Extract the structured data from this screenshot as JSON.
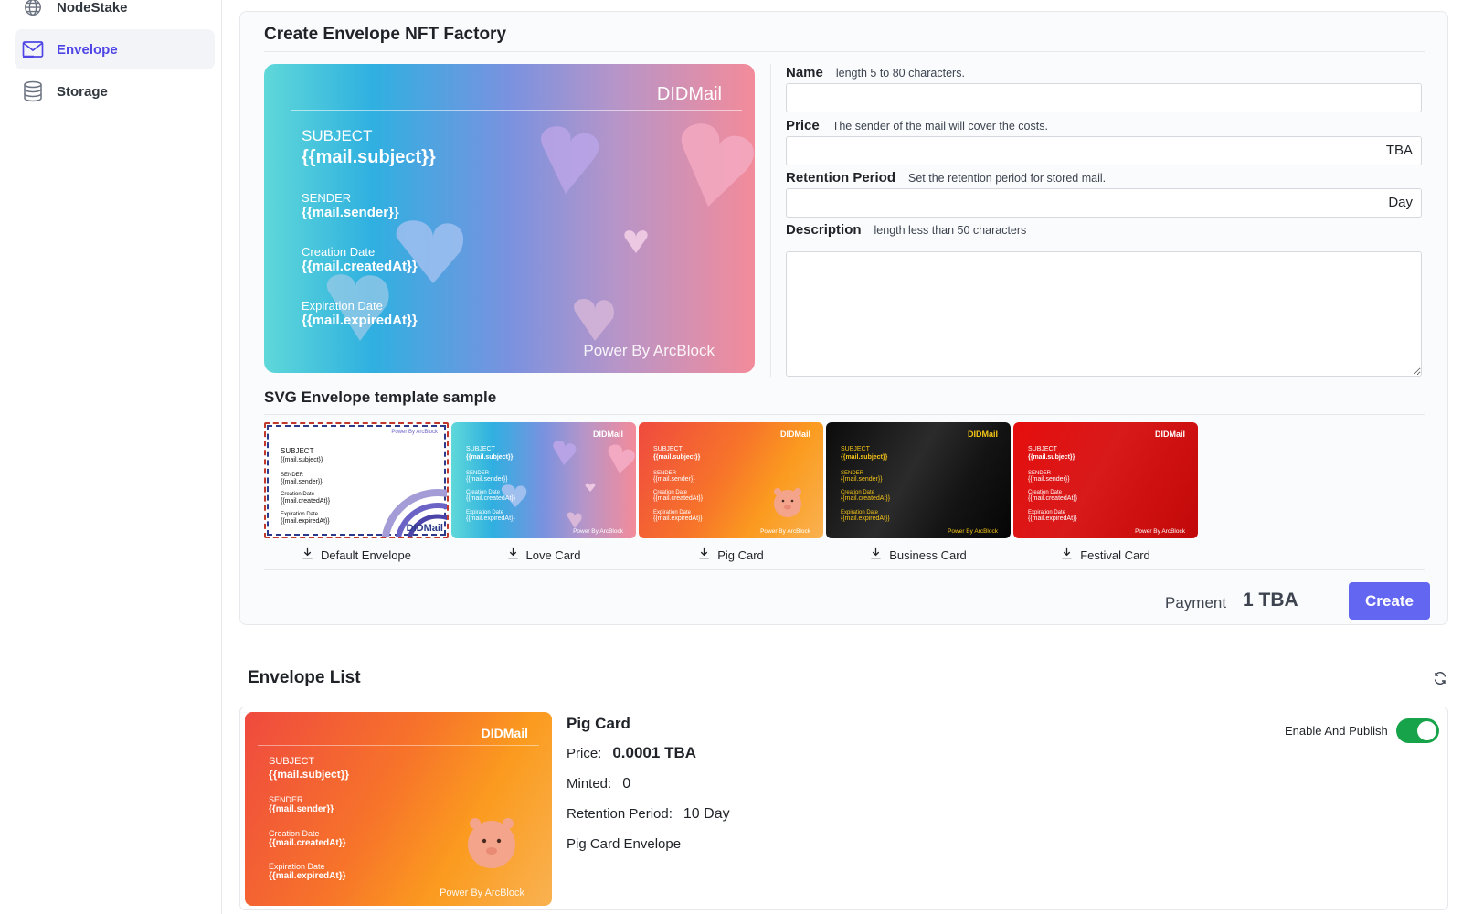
{
  "sidebar": {
    "items": [
      {
        "label": "NodeStake",
        "icon": "globe-icon"
      },
      {
        "label": "Envelope",
        "icon": "mail-icon"
      },
      {
        "label": "Storage",
        "icon": "database-icon"
      }
    ]
  },
  "factory": {
    "title": "Create Envelope NFT Factory",
    "preview": {
      "brand": "DIDMail",
      "subject_label": "SUBJECT",
      "subject_value": "{{mail.subject}}",
      "sender_label": "SENDER",
      "sender_value": "{{mail.sender}}",
      "created_label": "Creation Date",
      "created_value": "{{mail.createdAt}}",
      "expired_label": "Expiration Date",
      "expired_value": "{{mail.expiredAt}}",
      "power": "Power By ArcBlock"
    },
    "form": {
      "name_label": "Name",
      "name_hint": "length 5 to 80 characters.",
      "name_value": "",
      "price_label": "Price",
      "price_hint": "The sender of the mail will cover the costs.",
      "price_value": "",
      "price_suffix": "TBA",
      "retention_label": "Retention Period",
      "retention_hint": "Set the retention period for stored mail.",
      "retention_value": "",
      "retention_suffix": "Day",
      "description_label": "Description",
      "description_hint": "length less than 50 characters",
      "description_value": ""
    },
    "samples_title": "SVG Envelope template sample",
    "templates": [
      {
        "name": "Default Envelope",
        "brand": "DIDMail",
        "power": "Power By ArcBlock"
      },
      {
        "name": "Love Card",
        "brand": "DIDMail",
        "power": "Power By ArcBlock"
      },
      {
        "name": "Pig Card",
        "brand": "DIDMail",
        "power": "Power By ArcBlock"
      },
      {
        "name": "Business Card",
        "brand": "DIDMail",
        "power": "Power By ArcBlock"
      },
      {
        "name": "Festival Card",
        "brand": "DIDMail",
        "power": "Power By ArcBlock"
      }
    ],
    "template_fields": {
      "subject_label": "SUBJECT",
      "subject_value": "{{mail.subject}}",
      "sender_label": "SENDER",
      "sender_value": "{{mail.sender}}",
      "created_label": "Creation Date",
      "created_value": "{{mail.createdAt}}",
      "expired_label": "Expiration Date",
      "expired_value": "{{mail.expiredAt}}"
    },
    "payment_label": "Payment",
    "payment_value": "1 TBA",
    "create_label": "Create"
  },
  "envelope_list": {
    "title": "Envelope List",
    "items": [
      {
        "name": "Pig Card",
        "price_label": "Price:",
        "price_value": "0.0001 TBA",
        "minted_label": "Minted:",
        "minted_value": "0",
        "retention_label": "Retention Period:",
        "retention_value": "10 Day",
        "description": "Pig Card Envelope",
        "enable_label": "Enable And Publish",
        "enabled": true
      }
    ]
  },
  "colors": {
    "accent": "#6366f1",
    "active_nav": "#4f46e5",
    "toggle_on": "#16a34a"
  }
}
